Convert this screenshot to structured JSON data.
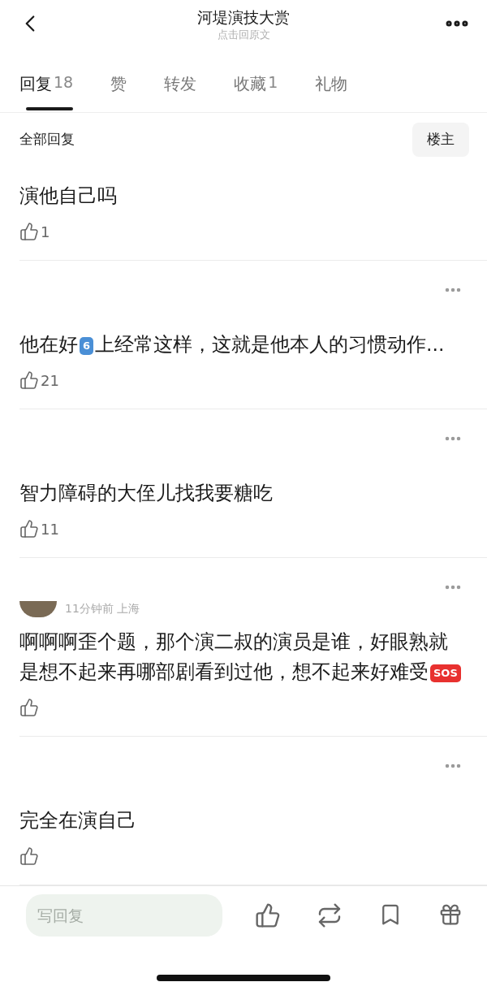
{
  "header": {
    "title": "河堤演技大赏",
    "subtitle": "点击回原文"
  },
  "tabs": [
    {
      "label": "回复",
      "count": "18",
      "selected": true
    },
    {
      "label": "赞",
      "selected": false
    },
    {
      "label": "转发",
      "selected": false
    },
    {
      "label": "收藏",
      "count": "1",
      "selected": false
    },
    {
      "label": "礼物",
      "selected": false
    }
  ],
  "filter": {
    "label": "全部回复",
    "button": "楼主"
  },
  "comments": [
    {
      "kind": "cut",
      "body": [
        {
          "kind": "text",
          "text": "演他自己吗"
        }
      ],
      "likes": "1"
    },
    {
      "kind": "full",
      "body": [
        {
          "kind": "text",
          "text": "他在好"
        },
        {
          "kind": "badge",
          "text": "6",
          "color": "#4a8fd6"
        },
        {
          "kind": "text",
          "text": "上经常这样，这就是他本人的习惯动作..."
        }
      ],
      "likes": "21"
    },
    {
      "kind": "full",
      "body": [
        {
          "kind": "text",
          "text": "智力障碍的大侄儿找我要糖吃"
        }
      ],
      "likes": "11"
    },
    {
      "kind": "full",
      "meta": "11分钟前 上海",
      "body": [
        {
          "kind": "text",
          "text": "啊啊啊歪个题，那个演二叔的演员是谁，好眼熟就是想不起来再哪部剧看到过他，想不起来好难受"
        },
        {
          "kind": "badge",
          "text": "SOS",
          "color": "#e8312f"
        }
      ]
    },
    {
      "kind": "full",
      "body": [
        {
          "kind": "text",
          "text": "完全在演自己"
        }
      ]
    }
  ],
  "reply_bar": {
    "placeholder": "写回复"
  }
}
